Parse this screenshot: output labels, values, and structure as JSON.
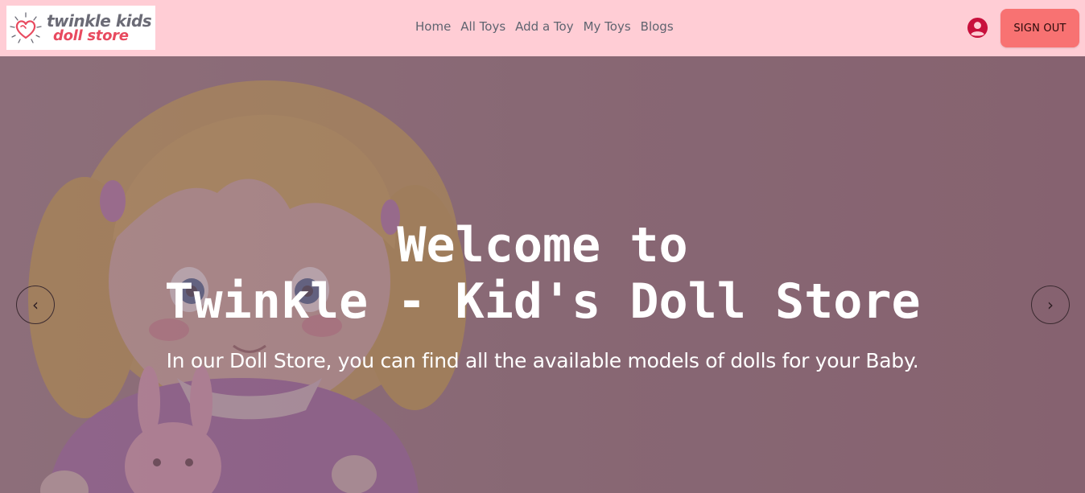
{
  "brand": {
    "line1": "twinkle kids",
    "line2": "doll store"
  },
  "nav": {
    "links": [
      {
        "label": "Home"
      },
      {
        "label": "All Toys"
      },
      {
        "label": "Add a Toy"
      },
      {
        "label": "My Toys"
      },
      {
        "label": "Blogs"
      }
    ],
    "user_icon": "user-circle-icon",
    "signout_label": "SIGN OUT"
  },
  "hero": {
    "title_line1": "Welcome to",
    "title_line2": "Twinkle - Kid's Doll Store",
    "subtitle": "In our Doll Store, you can find all the available models of dolls for your Baby.",
    "prev_label": "‹",
    "next_label": "›"
  },
  "colors": {
    "navbar_bg": "#ffcdd5",
    "signout_bg": "#f87272",
    "user_icon": "#c8103c",
    "hero_tint": "#8e727c"
  }
}
